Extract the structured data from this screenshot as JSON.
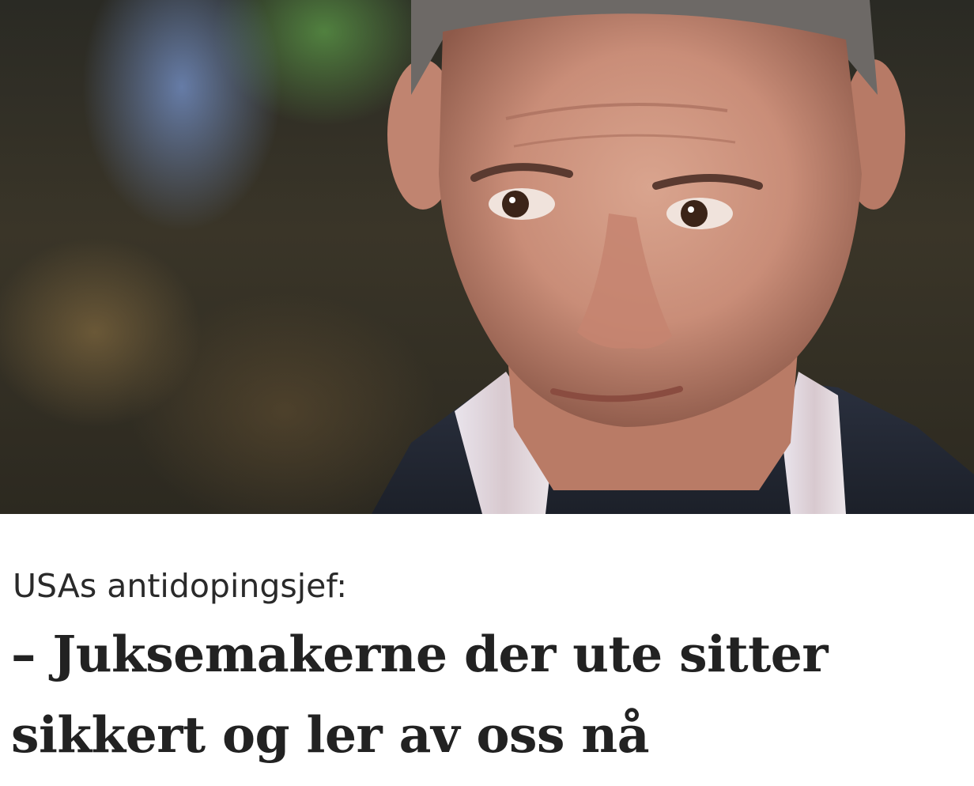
{
  "teaser": {
    "image_alt": "USAs antidopingsjef",
    "kicker": "USAs antidopingsjef:",
    "headline": "– Juksemakerne der ute sitter sikkert og ler av oss nå"
  }
}
